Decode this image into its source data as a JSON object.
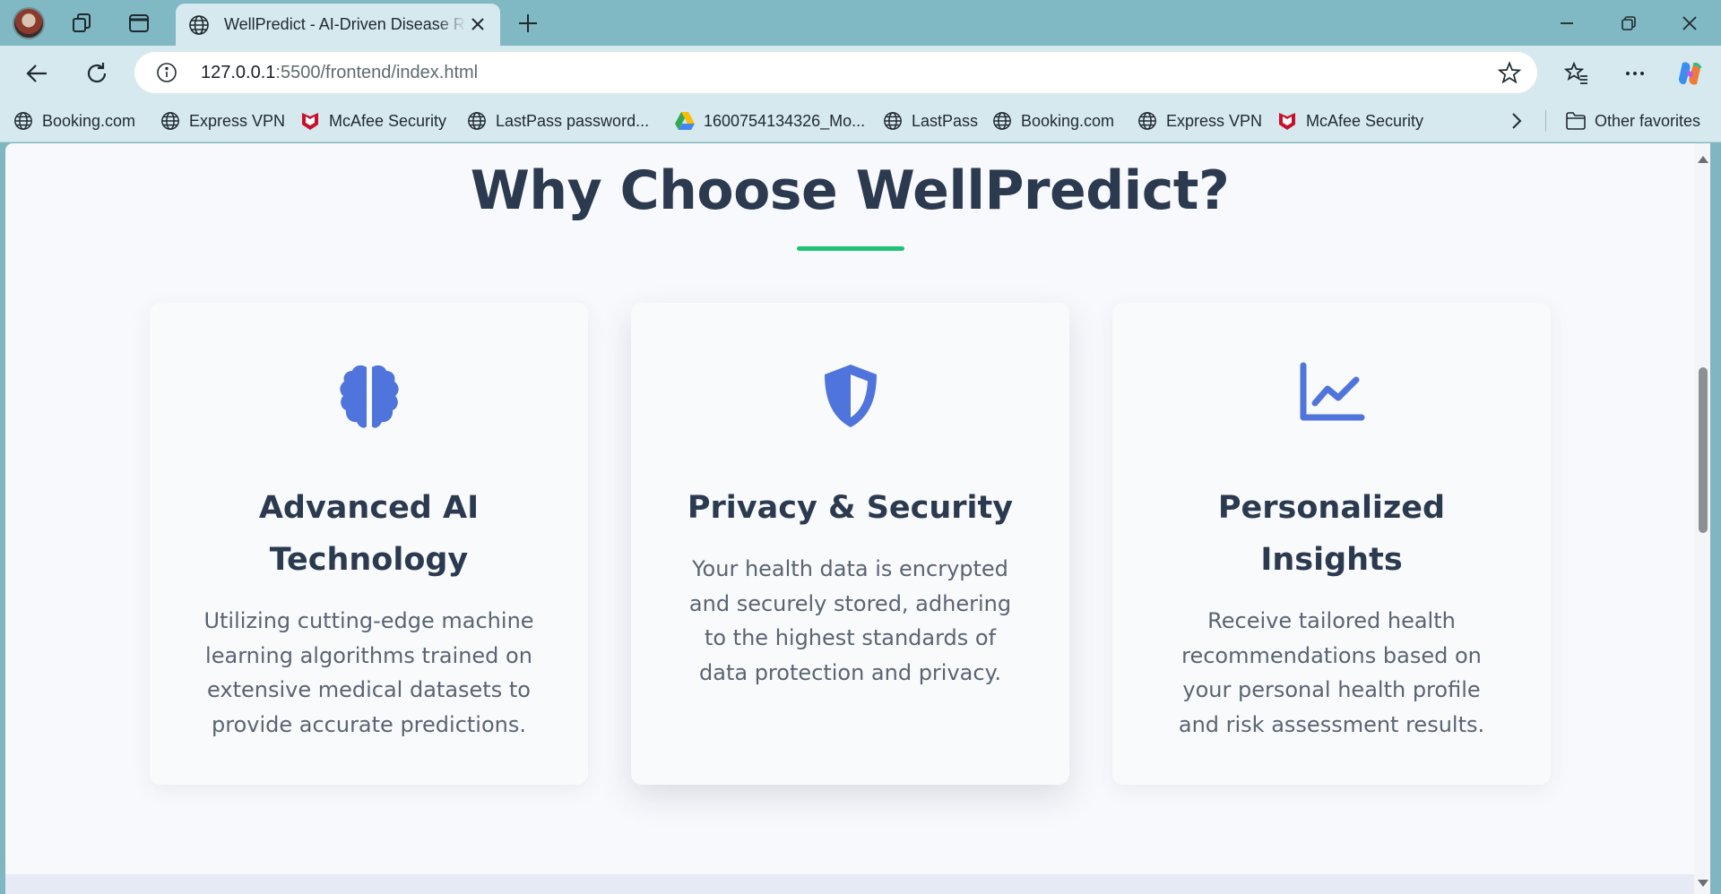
{
  "browser": {
    "tab_title": "WellPredict - AI-Driven Disease Risk",
    "url_host": "127.0.0.1",
    "url_path": ":5500/frontend/index.html",
    "bookmarks": [
      {
        "label": "Booking.com",
        "icon": "globe-icon"
      },
      {
        "label": "Express VPN",
        "icon": "globe-icon"
      },
      {
        "label": "McAfee Security",
        "icon": "mcafee-icon"
      },
      {
        "label": "LastPass password...",
        "icon": "globe-icon"
      },
      {
        "label": "1600754134326_Mo...",
        "icon": "google-drive-icon"
      },
      {
        "label": "LastPass",
        "icon": "globe-icon"
      },
      {
        "label": "Booking.com",
        "icon": "globe-icon"
      },
      {
        "label": "Express VPN",
        "icon": "globe-icon"
      },
      {
        "label": "McAfee Security",
        "icon": "mcafee-icon"
      }
    ],
    "other_favorites": "Other favorites"
  },
  "section": {
    "title": "Why Choose WellPredict?",
    "accent_color": "#21c276",
    "icon_color": "#4f74dc",
    "cards": [
      {
        "icon": "brain-icon",
        "title_line1": "Advanced AI",
        "title_line2": "Technology",
        "text": "Utilizing cutting-edge machine learning algorithms trained on extensive medical datasets to provide accurate predictions."
      },
      {
        "icon": "shield-icon",
        "title_line1": "Privacy & Security",
        "text": "Your health data is encrypted and securely stored, adhering to the highest standards of data protection and privacy."
      },
      {
        "icon": "chart-line-icon",
        "title_line1": "Personalized",
        "title_line2": "Insights",
        "text": "Receive tailored health recommendations based on your personal health profile and risk assessment results."
      }
    ]
  }
}
